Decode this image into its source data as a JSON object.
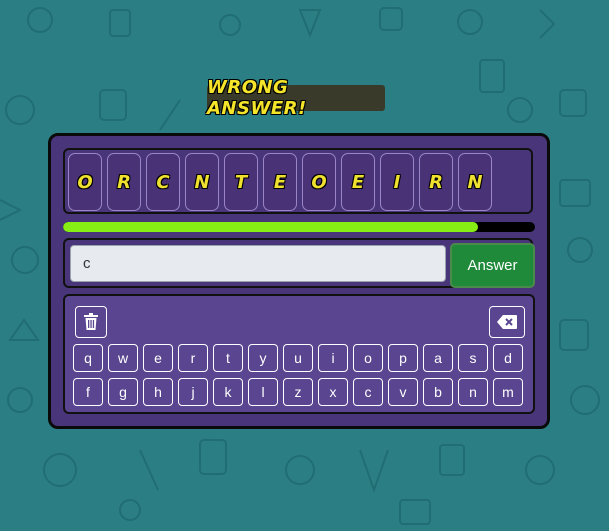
{
  "status": {
    "text": "WRONG ANSWER!"
  },
  "tiles": [
    "O",
    "R",
    "C",
    "N",
    "T",
    "E",
    "O",
    "E",
    "I",
    "R",
    "N"
  ],
  "progress": {
    "fraction": 0.88
  },
  "answer": {
    "value": "c",
    "button_label": "Answer"
  },
  "keyboard": {
    "row1": [
      "q",
      "w",
      "e",
      "r",
      "t",
      "y",
      "u",
      "i",
      "o",
      "p",
      "a",
      "s",
      "d"
    ],
    "row2": [
      "f",
      "g",
      "h",
      "j",
      "k",
      "l",
      "z",
      "x",
      "c",
      "v",
      "b",
      "n",
      "m"
    ],
    "clear_icon": "trash-icon",
    "backspace_icon": "backspace-icon"
  },
  "colors": {
    "background": "#2b7f84",
    "panel": "#49357a",
    "accent_yellow": "#f0e130",
    "progress": "#86ee14",
    "answer_button": "#1f8a3a"
  }
}
